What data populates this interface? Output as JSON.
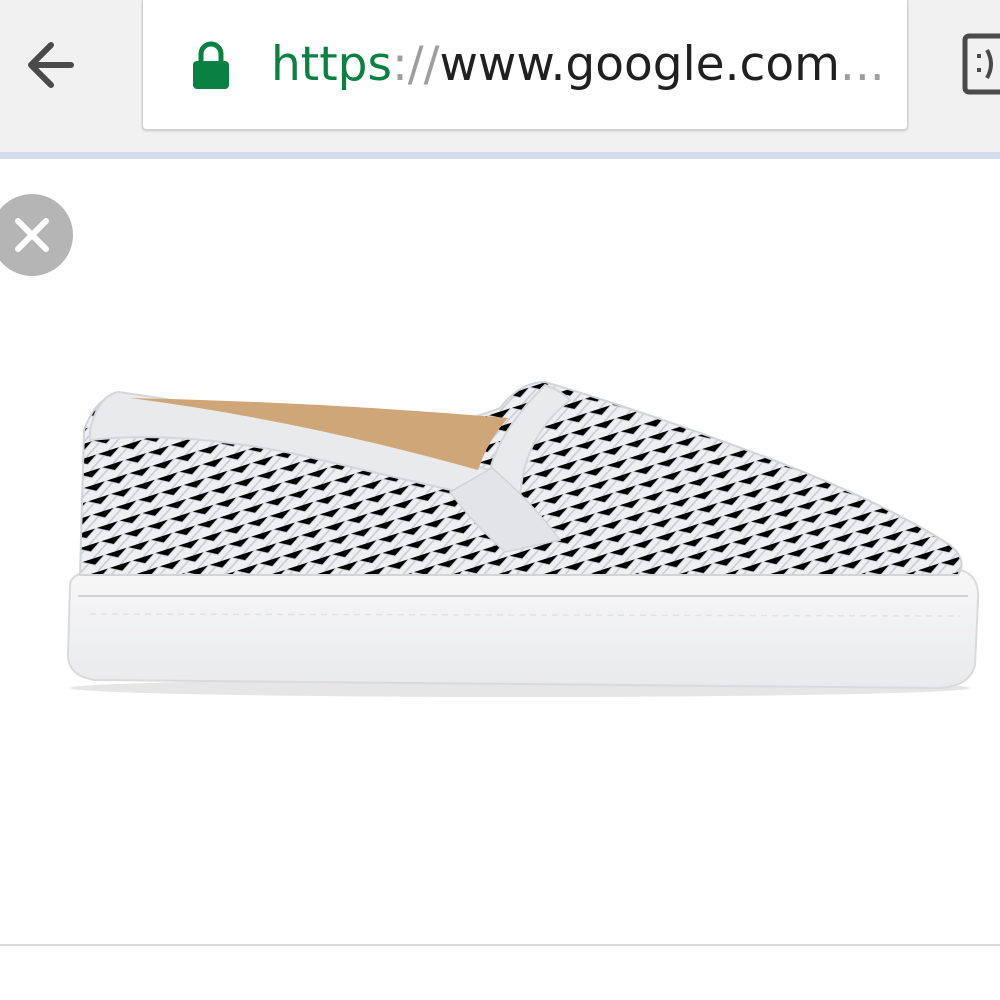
{
  "browser": {
    "url": {
      "scheme": "https",
      "separator": "://",
      "host": "www.google.com",
      "ellipsis": "..."
    },
    "icons": {
      "back": "arrow-left-icon",
      "lock": "lock-icon",
      "reader": "reader-mode-icon"
    },
    "colors": {
      "secure": "#0b8043",
      "toolbar_bg": "#f1f1f1"
    }
  },
  "viewer": {
    "icons": {
      "close": "close-icon"
    },
    "image": {
      "subject": "white woven leather slip-on sneaker"
    }
  }
}
